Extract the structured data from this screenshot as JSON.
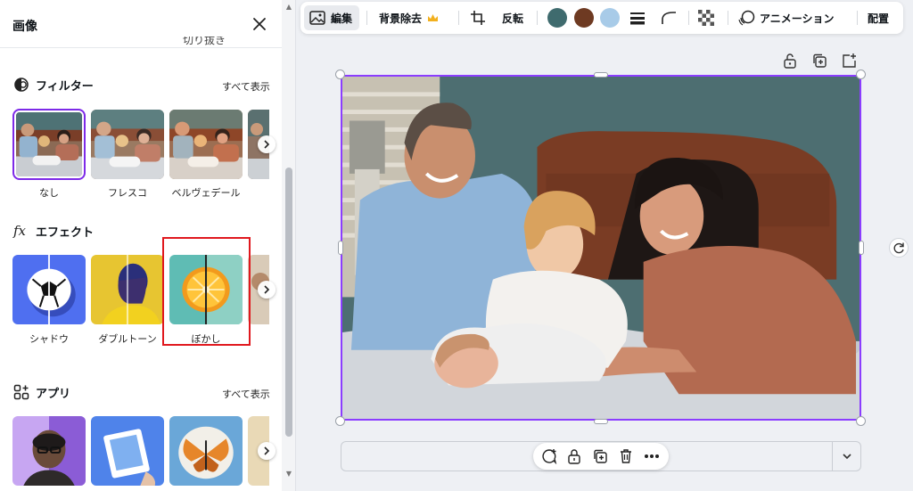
{
  "panel": {
    "title": "画像",
    "cut_text": "切り抜き",
    "filter": {
      "title": "フィルター",
      "see_all": "すべて表示",
      "items": [
        {
          "label": "なし"
        },
        {
          "label": "フレスコ"
        },
        {
          "label": "ベルヴェデール"
        }
      ]
    },
    "effect": {
      "title": "エフェクト",
      "items": [
        {
          "label": "シャドウ"
        },
        {
          "label": "ダブルトーン"
        },
        {
          "label": "ぼかし"
        }
      ]
    },
    "apps": {
      "title": "アプリ",
      "see_all": "すべて表示"
    }
  },
  "toolbar": {
    "edit": "編集",
    "bg_remove": "背景除去",
    "flip": "反転",
    "animation": "アニメーション",
    "arrange": "配置",
    "colors": [
      "#3f6b6e",
      "#6e3a22",
      "#a8cbe8"
    ]
  },
  "colors": {
    "accent": "#8b3dff",
    "highlight": "#e0181e",
    "crown": "#f2b01e"
  }
}
